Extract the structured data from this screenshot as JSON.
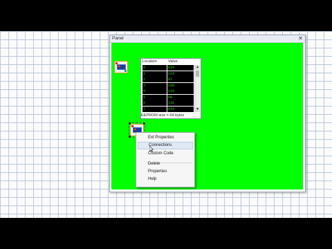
{
  "window": {
    "title": "Panel",
    "close_symbol": "✕"
  },
  "colors": {
    "panel_background": "#00ff00",
    "grid_line": "#b9c7dd",
    "eeprom_text": "#34d000"
  },
  "eeprom": {
    "headers": {
      "location": "Location",
      "value": "Value"
    },
    "rows": [
      {
        "location": "0",
        "value": "034"
      },
      {
        "location": "1",
        "value": "114"
      },
      {
        "location": "2",
        "value": "07"
      },
      {
        "location": "3",
        "value": "160"
      },
      {
        "location": "4",
        "value": "110"
      },
      {
        "location": "5",
        "value": "00"
      },
      {
        "location": "6",
        "value": "131"
      },
      {
        "location": "7",
        "value": "034"
      }
    ],
    "size_label": "EEPROM size = 64 bytes",
    "scroll_up": "▲",
    "scroll_down": "▼"
  },
  "context_menu": {
    "items": [
      {
        "label": "Ext Properties",
        "highlighted": false
      },
      {
        "label": "Connections",
        "highlighted": true
      },
      {
        "label": "Custom Code",
        "highlighted": false
      },
      {
        "label": "Delete",
        "highlighted": false
      },
      {
        "label": "Properties",
        "highlighted": false
      },
      {
        "label": "Help",
        "highlighted": false
      }
    ]
  },
  "icons": {
    "device": "eeprom-chip-icon",
    "close": "close-icon",
    "cursor": "mouse-pointer-icon"
  }
}
